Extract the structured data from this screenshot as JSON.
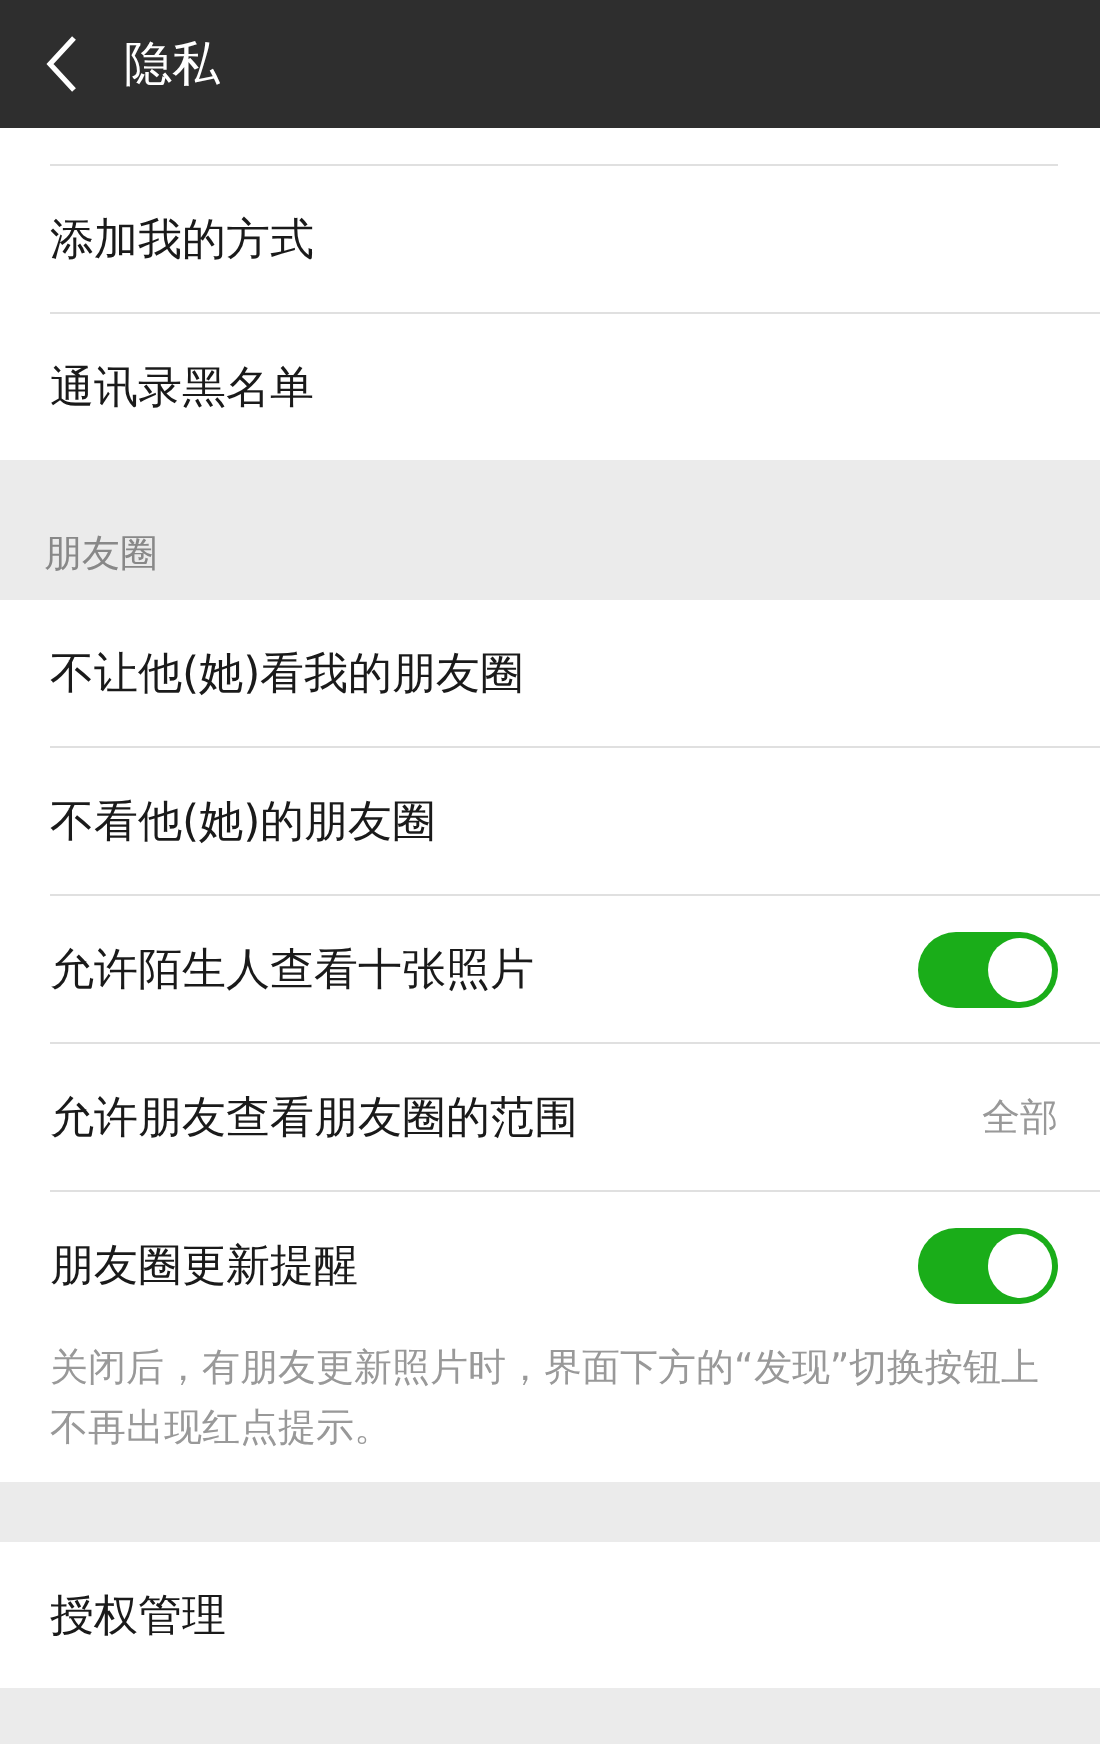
{
  "header": {
    "title": "隐私"
  },
  "top_rows": [
    {
      "label": "添加我的方式"
    },
    {
      "label": "通讯录黑名单"
    }
  ],
  "moments": {
    "section_label": "朋友圈",
    "rows": [
      {
        "kind": "link",
        "label": "不让他(她)看我的朋友圈"
      },
      {
        "kind": "link",
        "label": "不看他(她)的朋友圈"
      },
      {
        "kind": "toggle",
        "label": "允许陌生人查看十张照片",
        "on": true
      },
      {
        "kind": "value",
        "label": "允许朋友查看朋友圈的范围",
        "value": "全部"
      },
      {
        "kind": "toggle",
        "label": "朋友圈更新提醒",
        "on": true
      }
    ],
    "note": "关闭后，有朋友更新照片时，界面下方的“发现”切换按钮上不再出现红点提示。"
  },
  "bottom_rows": [
    {
      "label": "授权管理"
    }
  ]
}
